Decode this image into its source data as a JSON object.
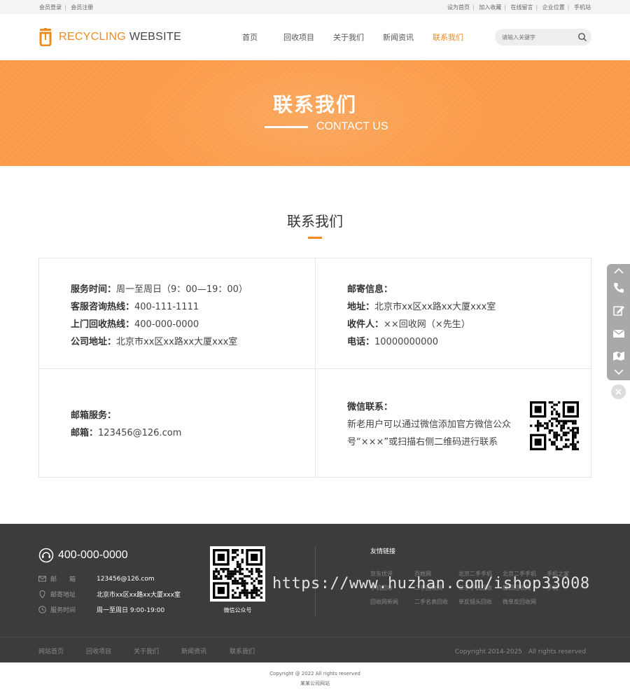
{
  "topbar": {
    "left": [
      "会员登录",
      "会员注册"
    ],
    "right": [
      "设为首页",
      "加入收藏",
      "在线留言",
      "企业位置",
      "手机站"
    ]
  },
  "logo": {
    "text_a": "RECYCLING",
    "text_b": "WEBSITE",
    "brand_color": "#f08a1d"
  },
  "nav": [
    {
      "label": "首页",
      "active": false
    },
    {
      "label": "回收项目",
      "active": false
    },
    {
      "label": "关于我们",
      "active": false
    },
    {
      "label": "新闻资讯",
      "active": false
    },
    {
      "label": "联系我们",
      "active": true
    }
  ],
  "search": {
    "placeholder": "请输入关键字",
    "icon": "search-icon"
  },
  "banner": {
    "title": "联系我们",
    "subtitle": "CONTACT US",
    "color": "#fb9b48"
  },
  "section": {
    "title": "联系我们"
  },
  "contact": {
    "service": [
      {
        "label": "服务时间：",
        "value": "周一至周日（9：00—19：00）"
      },
      {
        "label": "客服咨询热线：",
        "value": "400-111-1111"
      },
      {
        "label": "上门回收热线：",
        "value": "400-000-0000"
      },
      {
        "label": "公司地址：",
        "value": "北京市xx区xx路xx大厦xxx室"
      }
    ],
    "mail": [
      {
        "label": "邮寄信息：",
        "value": ""
      },
      {
        "label": "地址：",
        "value": "北京市xx区xx路xx大厦xxx室"
      },
      {
        "label": "收件人：",
        "value": "××回收网（×先生）"
      },
      {
        "label": "电话：",
        "value": "10000000000"
      }
    ],
    "email_title": "邮箱服务：",
    "email_label": "邮箱：",
    "email_value": "123456@126.com",
    "wechat_title": "微信联系：",
    "wechat_line1": "新老用户可以通过微信添加官方微信公众",
    "wechat_line2": "号“×××”或扫描右侧二维码进行联系"
  },
  "footer": {
    "phone": "400-000-0000",
    "info": [
      {
        "label": "邮　　箱",
        "value": "123456@126.com",
        "icon": "mail-icon"
      },
      {
        "label": "邮寄地址",
        "value": "北京市xx区xx路xx大厦xxx室",
        "icon": "location-icon"
      },
      {
        "label": "服务时间",
        "value": "周一至周日 9:00-19:00",
        "icon": "clock-icon"
      }
    ],
    "qr_label": "微信公众号",
    "links_title": "友情链接",
    "links": [
      [
        "京东优评",
        "百姓网",
        "北京二手手机",
        "北京二手手机",
        "手机之家"
      ],
      [
        "手机回收",
        "二手回收网",
        "二手手机回收",
        "废旧回收网",
        "手机"
      ],
      [
        "回收网新闻",
        "二手名表回收",
        "单反镜头回收",
        "微单反回收网"
      ]
    ]
  },
  "bottom_nav": [
    "网站首页",
    "回收项目",
    "关于我们",
    "新闻资讯",
    "联系我们"
  ],
  "bottom_copy": "Copyright 2014-2025　All rights reserved",
  "copyright": [
    "Copyright @ 2022  All rights reserved",
    "某某公司网站"
  ],
  "watermark": "https://www.huzhan.com/ishop33008"
}
